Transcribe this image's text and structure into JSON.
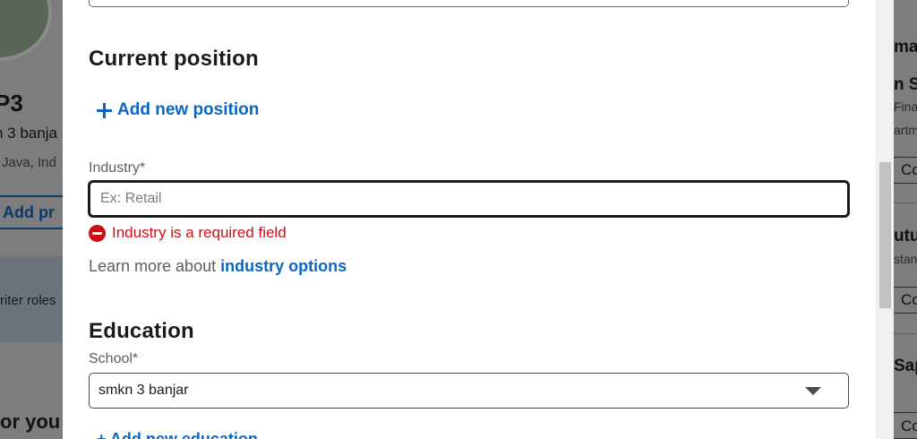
{
  "background_left": {
    "name": "P3",
    "subtitle": "n 3 banja",
    "location": "Java, Ind",
    "button": "Add pr",
    "card_text": "riter roles",
    "heading": "or you"
  },
  "background_right": {
    "items": [
      "ma",
      "n Sy",
      "Fina",
      "artm",
      "Co",
      "utu",
      "stan",
      "Co",
      "Sap",
      "Co"
    ]
  },
  "modal": {
    "current_position": {
      "title": "Current position",
      "add_link": "Add new position"
    },
    "industry": {
      "label": "Industry*",
      "value": "",
      "placeholder": "Ex: Retail",
      "error": "Industry is a required field",
      "learn_prefix": "Learn more about ",
      "learn_link": "industry options"
    },
    "education": {
      "title": "Education",
      "school_label": "School*",
      "school_value": "smkn 3 banjar",
      "add_link_partial": "+ Add new education"
    }
  },
  "colors": {
    "link_blue": "#0a66c2",
    "error_red": "#cc1016",
    "overlay_gray": "#7d7d7d"
  },
  "icons": {
    "plus": "plus-icon",
    "error": "error-icon",
    "dropdown": "chevron-down-icon"
  }
}
